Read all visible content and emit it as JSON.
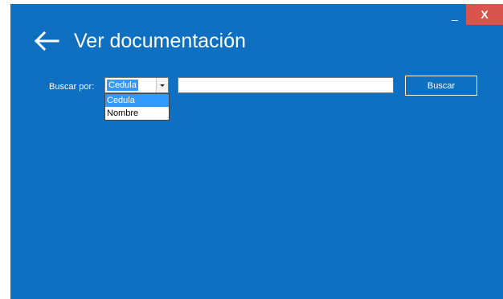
{
  "window": {
    "minimize_label": "_",
    "close_label": "X"
  },
  "header": {
    "back_icon": "arrow-left-icon",
    "title": "Ver documentación"
  },
  "search": {
    "label": "Buscar por:",
    "selected_option": "Cedula",
    "options": [
      "Cedula",
      "Nombre"
    ],
    "input_value": "",
    "button_label": "Buscar"
  },
  "colors": {
    "background": "#0f6fc1",
    "close_button": "#d9534f",
    "selection": "#3399ff"
  }
}
